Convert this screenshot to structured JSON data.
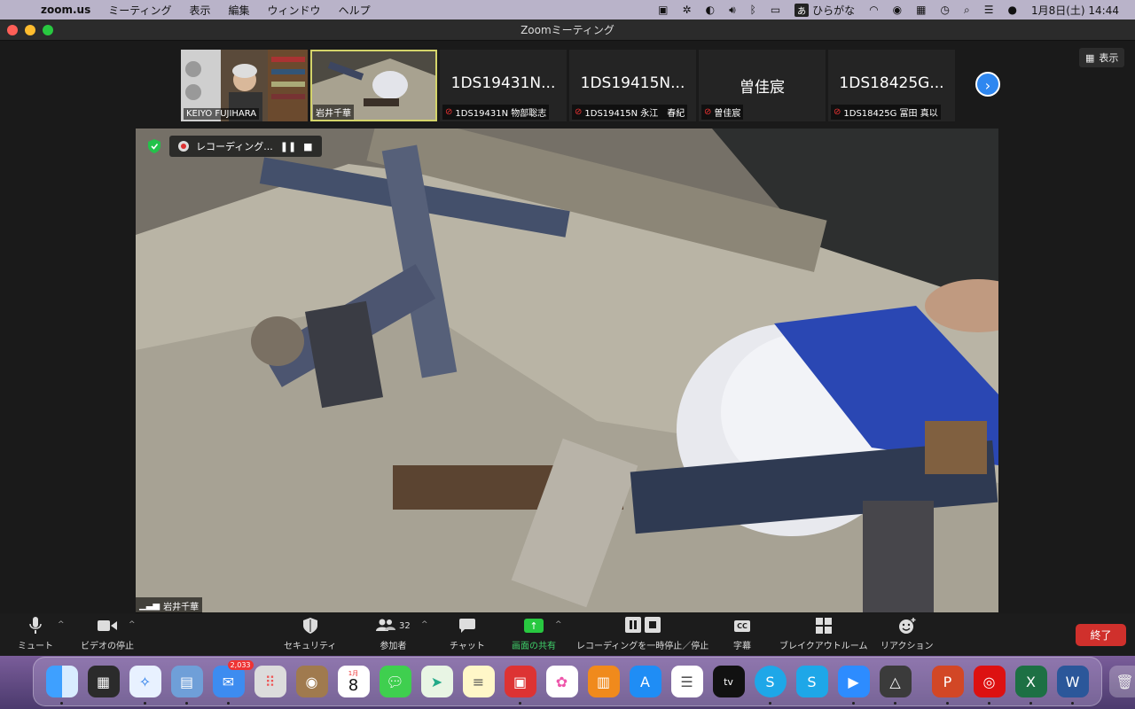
{
  "menubar": {
    "app_name": "zoom.us",
    "items": [
      "ミーティング",
      "表示",
      "編集",
      "ウィンドウ",
      "ヘルプ"
    ],
    "ime_label": "ひらがな",
    "ime_box": "あ",
    "clock": "1月8日(土)  14:44"
  },
  "window": {
    "title": "Zoomミーティング"
  },
  "strip": {
    "tiles": [
      {
        "caption": "KEIYO FUJIHARA",
        "big": "",
        "muted": false
      },
      {
        "caption": "岩井千華",
        "big": "",
        "muted": false
      },
      {
        "caption": "1DS19431N 物部聡志",
        "big": "1DS19431N...",
        "muted": true
      },
      {
        "caption": "1DS19415N 永江　春紀",
        "big": "1DS19415N...",
        "muted": true
      },
      {
        "caption": "曽佳宸",
        "big": "曽佳宸",
        "muted": true
      },
      {
        "caption": "1DS18425G 冨田 真以",
        "big": "1DS18425G...",
        "muted": true
      }
    ],
    "next_icon": "chevron-right-icon",
    "view_label": "表示"
  },
  "main_video": {
    "recording_label": "レコーディング...",
    "speaker_name": "岩井千華"
  },
  "toolbar": {
    "mute": "ミュート",
    "video": "ビデオの停止",
    "security": "セキュリティ",
    "participants": "参加者",
    "participants_count": "32",
    "chat": "チャット",
    "share": "画面の共有",
    "recording": "レコーディングを一時停止／停止",
    "captions": "字幕",
    "captions_icon_text": "CC",
    "breakout": "ブレイクアウトルーム",
    "reactions": "リアクション",
    "end": "終了"
  },
  "dock": {
    "mail_badge": "2,033",
    "calendar_month": "1月",
    "calendar_day": "8",
    "tv_label": "tv"
  },
  "colors": {
    "accent_green": "#28c840",
    "end_red": "#d0302c",
    "active_speaker_outline": "#d4d46a",
    "muted_red": "#e33333"
  }
}
